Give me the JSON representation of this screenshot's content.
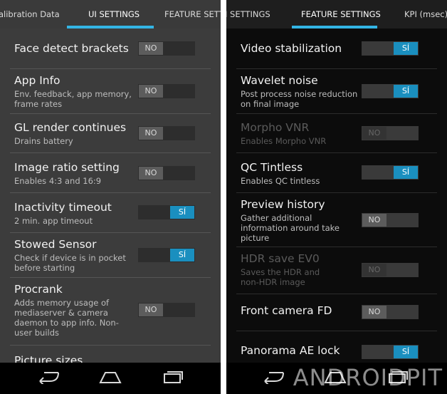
{
  "left": {
    "tabs": [
      "alibration Data",
      "UI SETTINGS",
      "FEATURE SETTI"
    ],
    "selected_tab": 1,
    "items": [
      {
        "title": "Face detect brackets",
        "subtitle": "",
        "state": "NO"
      },
      {
        "title": "App Info",
        "subtitle": "Env. feedback, app memory, frame rates",
        "state": "NO"
      },
      {
        "title": "GL render continues",
        "subtitle": "Drains battery",
        "state": "NO"
      },
      {
        "title": "Image ratio setting",
        "subtitle": "Enables 4:3 and 16:9",
        "state": "NO"
      },
      {
        "title": "Inactivity timeout",
        "subtitle": "2 min. app timeout",
        "state": "SÍ"
      },
      {
        "title": "Stowed Sensor",
        "subtitle": "Check if device is in pocket before starting",
        "state": "SÍ"
      },
      {
        "title": "Procrank",
        "subtitle": "Adds memory usage of mediaserver & camera daemon to app info. Non-user builds",
        "state": "NO"
      },
      {
        "title": "Picture sizes",
        "subtitle": "",
        "state": ""
      }
    ]
  },
  "right": {
    "tabs": [
      "I SETTINGS",
      "FEATURE SETTINGS",
      "KPI (msec)"
    ],
    "selected_tab": 1,
    "items": [
      {
        "title": "Video stabilization",
        "subtitle": "",
        "state": "SÍ",
        "disabled": false
      },
      {
        "title": "Wavelet noise",
        "subtitle": "Post process noise reduction on final image",
        "state": "SÍ",
        "disabled": false
      },
      {
        "title": "Morpho VNR",
        "subtitle": "Enables Morpho VNR",
        "state": "NO",
        "disabled": true
      },
      {
        "title": "QC Tintless",
        "subtitle": "Enables QC tintless",
        "state": "SÍ",
        "disabled": false
      },
      {
        "title": "Preview history",
        "subtitle": "Gather additional information around take picture",
        "state": "NO",
        "disabled": false
      },
      {
        "title": "HDR save EV0",
        "subtitle": "Saves the HDR and non-HDR image",
        "state": "NO",
        "disabled": true
      },
      {
        "title": "Front camera FD",
        "subtitle": "",
        "state": "NO",
        "disabled": false
      },
      {
        "title": "Panorama AE lock",
        "subtitle": "",
        "state": "SÍ",
        "disabled": false
      }
    ]
  },
  "watermark": "ANDROIDPIT",
  "icons": {
    "back": "back-icon",
    "home": "home-icon",
    "recents": "recents-icon"
  },
  "colors": {
    "accent": "#33b5e5",
    "toggle_on": "#1a8fbf"
  }
}
